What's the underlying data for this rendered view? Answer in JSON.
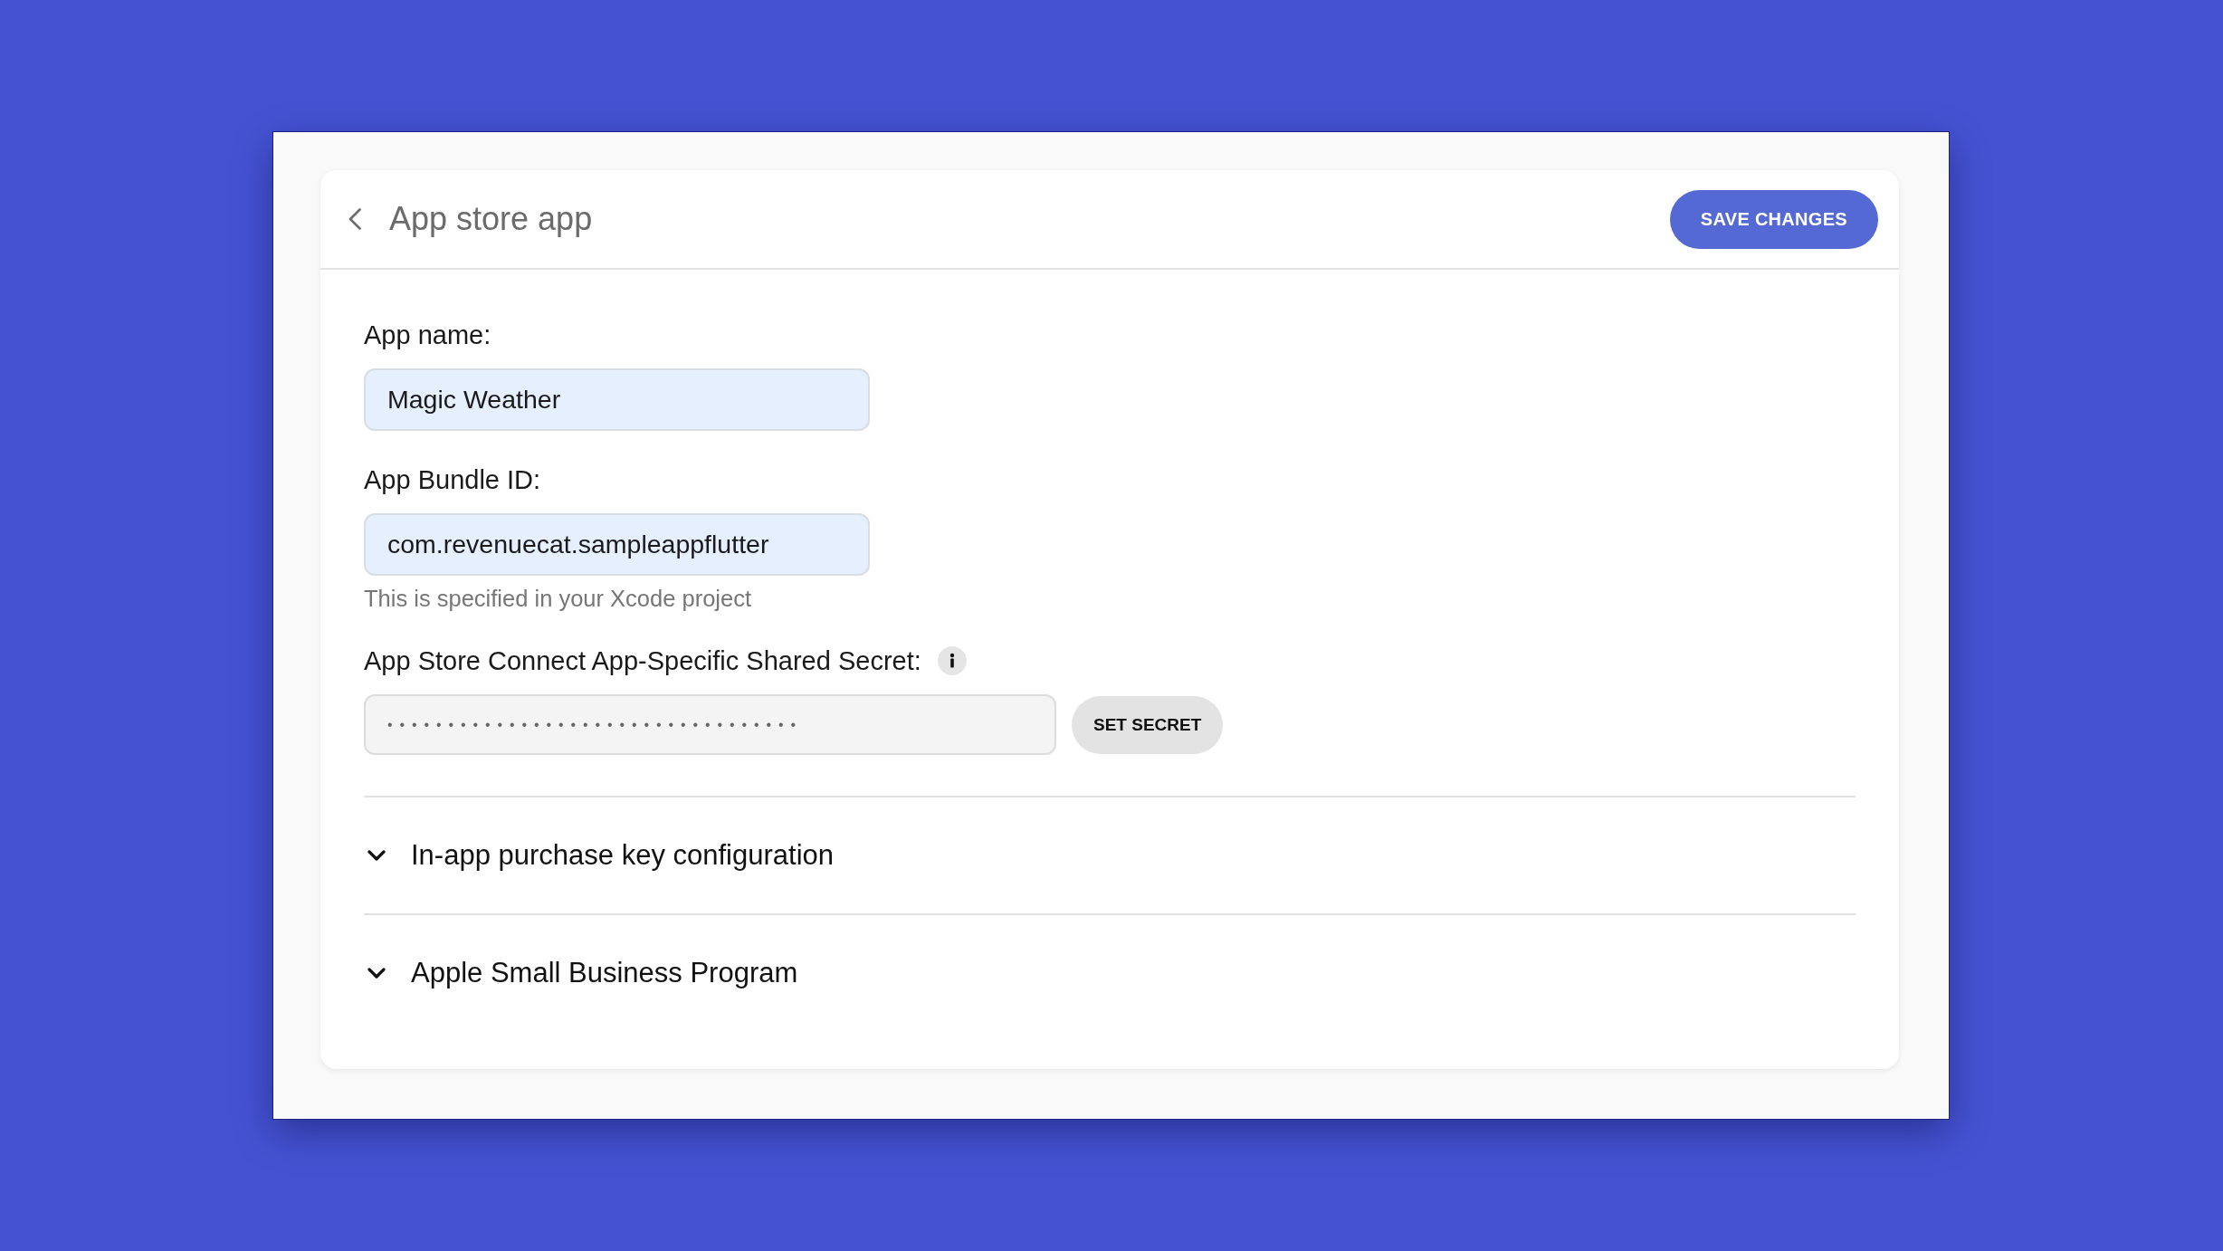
{
  "header": {
    "title": "App store app",
    "save_button": "SAVE CHANGES"
  },
  "fields": [
    {
      "kind": "text",
      "label": "App name:",
      "value": "Magic Weather"
    },
    {
      "kind": "text",
      "label": "App Bundle ID:",
      "value": "com.revenuecat.sampleappflutter",
      "hint": "This is specified in your Xcode project"
    },
    {
      "kind": "secret",
      "label": "App Store Connect App-Specific Shared Secret:",
      "info": true,
      "value": "••••••••••••••••••••••••••••••••••",
      "button": "SET SECRET"
    }
  ],
  "sections": [
    {
      "title": "In-app purchase key configuration",
      "expanded": false
    },
    {
      "title": "Apple Small Business Program",
      "expanded": false
    }
  ]
}
